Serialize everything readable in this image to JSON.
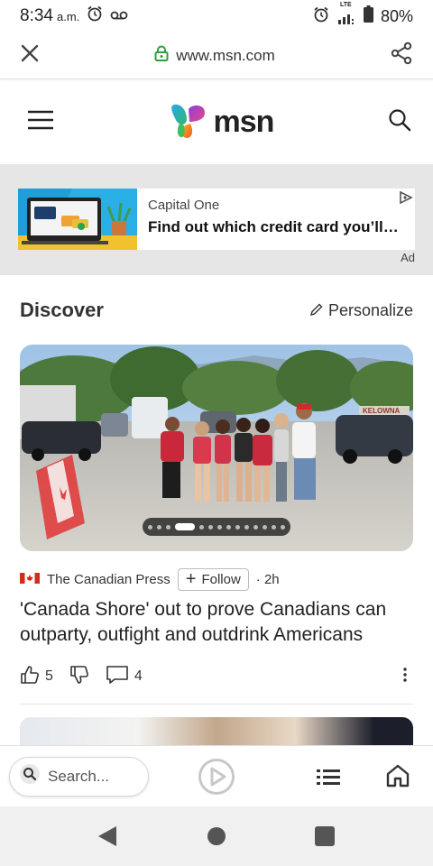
{
  "status_bar": {
    "time": "8:34",
    "ampm": "a.m.",
    "network": "LTE",
    "battery": "80%"
  },
  "browser": {
    "url": "www.msn.com",
    "close_icon": "close-icon",
    "lock_icon": "lock-icon",
    "share_icon": "share-icon"
  },
  "header": {
    "brand": "msn",
    "menu_icon": "hamburger-menu-icon",
    "search_icon": "search-icon"
  },
  "ad": {
    "sponsor": "Capital One",
    "headline": "Find out which credit card you’ll be approved for",
    "label": "Ad"
  },
  "discover": {
    "title": "Discover",
    "personalize_label": "Personalize"
  },
  "story": {
    "source": "The Canadian Press",
    "follow_label": "Follow",
    "time": "· 2h",
    "headline": "'Canada Shore' out to prove Canadians can outparty, outfight and outdrink Americans",
    "likes": "5",
    "comments": "4",
    "image_sign": "KELOWNA",
    "carousel_dots": 14,
    "carousel_active": 3
  },
  "bottom_bar": {
    "search_placeholder": "Search..."
  },
  "colors": {
    "brand_blue": "#2f7fe8",
    "brand_purple": "#8a3fd8",
    "brand_orange": "#f39a1e",
    "brand_green": "#3fbf5f",
    "lock_green": "#2e9e3e",
    "nav_bg": "#f0f0f0"
  }
}
